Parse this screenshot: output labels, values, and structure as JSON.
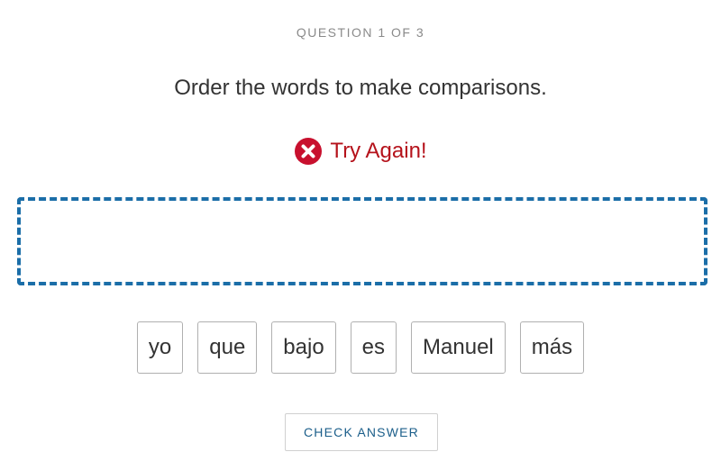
{
  "header": {
    "progress": "QUESTION 1 OF 3"
  },
  "question": {
    "prompt": "Order the words to make comparisons."
  },
  "feedback": {
    "icon": "error-x-icon",
    "text": "Try Again!",
    "color": "#b5121b"
  },
  "answer_area": {
    "border_color": "#1b6ea8"
  },
  "word_bank": {
    "tiles": [
      "yo",
      "que",
      "bajo",
      "es",
      "Manuel",
      "más"
    ]
  },
  "actions": {
    "check_label": "CHECK ANSWER"
  }
}
